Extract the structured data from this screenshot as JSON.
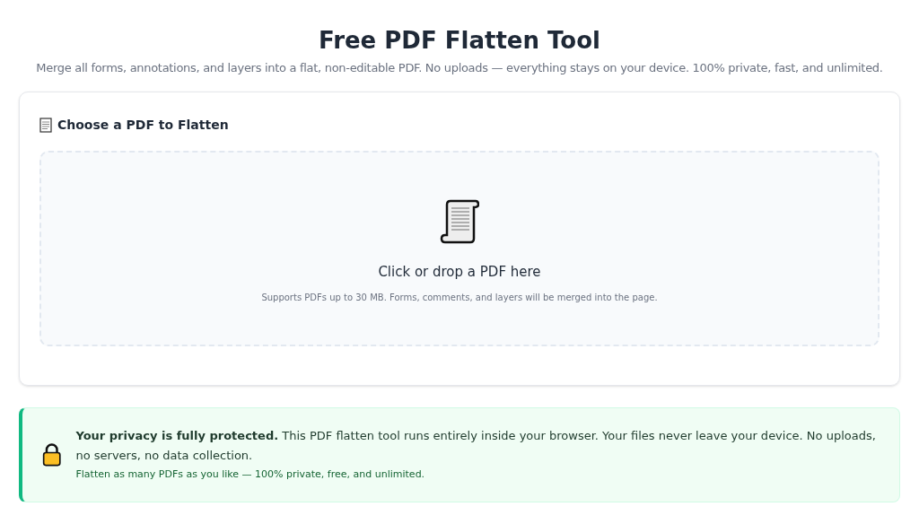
{
  "header": {
    "title": "Free PDF Flatten Tool",
    "subtitle": "Merge all forms, annotations, and layers into a flat, non-editable PDF. No uploads — everything stays on your device. 100% private, fast, and unlimited."
  },
  "upload_card": {
    "heading": "Choose a PDF to Flatten",
    "dropzone": {
      "label": "Click or drop a PDF here",
      "hint": "Supports PDFs up to 30 MB. Forms, comments, and layers will be merged into the page."
    }
  },
  "privacy_notice": {
    "text": "**Your privacy is fully protected.** This PDF flatten tool runs entirely inside your browser. Your files never leave your device. No uploads, no servers, no data collection.",
    "note": "Flatten as many PDFs as you like — 100% private, free, and unlimited."
  }
}
